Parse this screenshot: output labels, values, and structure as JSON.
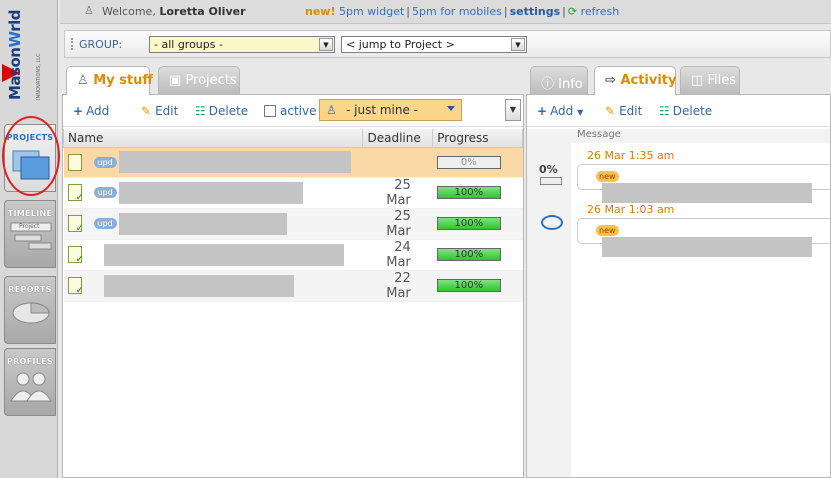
{
  "brand": {
    "name_a": "Mason",
    "name_b": "W",
    "name_c": "rld",
    "tagline": "INNOVATIONS, LLC"
  },
  "nav": [
    {
      "id": "projects",
      "label": "PROJECTS"
    },
    {
      "id": "timeline",
      "label": "TIMELINE",
      "sub": "Project"
    },
    {
      "id": "reports",
      "label": "REPORTS"
    },
    {
      "id": "profiles",
      "label": "PROFILES"
    }
  ],
  "topbar": {
    "welcome_prefix": "Welcome,",
    "user": "Loretta Oliver",
    "new_label": "new!",
    "link_widget": "5pm widget",
    "link_mobile": "5pm for mobiles",
    "link_settings": "settings",
    "link_refresh": "refresh"
  },
  "groupbar": {
    "label": "GROUP:",
    "group_value": "- all groups -",
    "jump_value": "< jump to Project >"
  },
  "left_tabs": [
    {
      "label": "My stuff"
    },
    {
      "label": "Projects"
    }
  ],
  "right_tabs": [
    {
      "label": "Info"
    },
    {
      "label": "Activity"
    },
    {
      "label": "Files"
    }
  ],
  "left_toolbar": {
    "add": "Add",
    "edit": "Edit",
    "delete": "Delete",
    "active": "active",
    "filter": "- just mine -"
  },
  "right_toolbar": {
    "add": "Add",
    "edit": "Edit",
    "delete": "Delete"
  },
  "grid": {
    "columns": [
      "Name",
      "Deadline",
      "Progress"
    ],
    "rows": [
      {
        "upd": "upd",
        "deadline": "",
        "progress": 0,
        "progress_label": "0%"
      },
      {
        "upd": "upd",
        "deadline": "25 Mar",
        "progress": 100,
        "progress_label": "100%"
      },
      {
        "upd": "upd",
        "deadline": "25 Mar",
        "progress": 100,
        "progress_label": "100%"
      },
      {
        "upd": "",
        "deadline": "24 Mar",
        "progress": 100,
        "progress_label": "100%"
      },
      {
        "upd": "",
        "deadline": "22 Mar",
        "progress": 100,
        "progress_label": "100%"
      }
    ]
  },
  "activity": {
    "header": "Message",
    "pct_label": "0%",
    "items": [
      {
        "time": "26 Mar 1:35 am",
        "badge": "new"
      },
      {
        "time": "26 Mar 1:03 am",
        "badge": "new"
      }
    ]
  }
}
